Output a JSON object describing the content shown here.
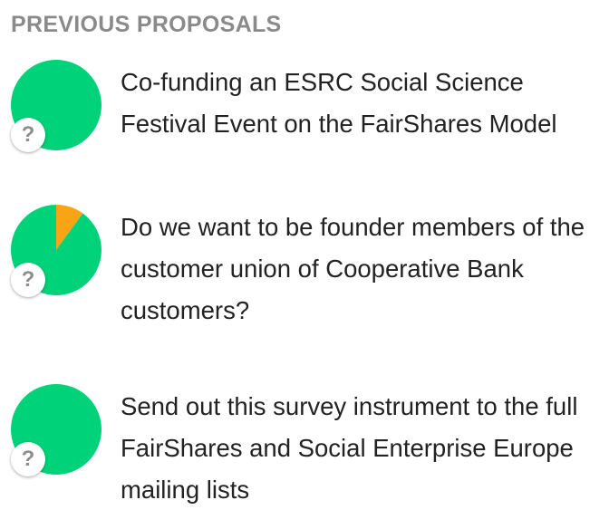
{
  "section": {
    "heading": "PREVIOUS PROPOSALS"
  },
  "colors": {
    "agree": "#00d27a",
    "abstain": "#f7a514",
    "badge_text": "#8e8e8e",
    "heading": "#8a8a8a"
  },
  "proposals": [
    {
      "title": "Co-funding an ESRC Social Science Festival Event on the FairShares Model",
      "badge": "?",
      "icon": "pie-chart-icon",
      "vote_shares": {
        "agree": 1.0,
        "abstain": 0.0
      }
    },
    {
      "title": "Do we want to be founder members of the customer union of Cooperative Bank customers?",
      "badge": "?",
      "icon": "pie-chart-icon",
      "vote_shares": {
        "agree": 0.9,
        "abstain": 0.1
      }
    },
    {
      "title": "Send out this survey instrument to the full FairShares and Social Enterprise Europe mailing lists",
      "badge": "?",
      "icon": "pie-chart-icon",
      "vote_shares": {
        "agree": 1.0,
        "abstain": 0.0
      }
    }
  ]
}
